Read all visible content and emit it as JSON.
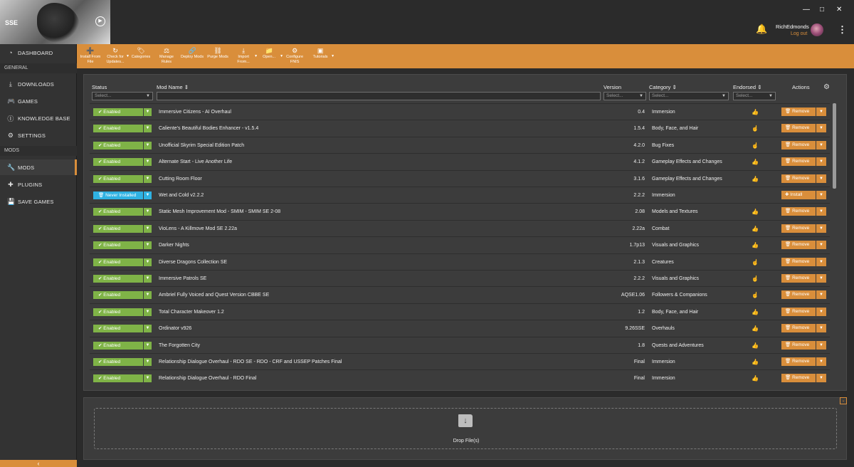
{
  "game": {
    "label": "SSE"
  },
  "window": {
    "minimize": "—",
    "maximize": "□",
    "close": "✕"
  },
  "user": {
    "name": "RichEdmonds",
    "logout": "Log out"
  },
  "sidebar": {
    "dashboard": "DASHBOARD",
    "section_general": "GENERAL",
    "downloads": "DOWNLOADS",
    "games": "GAMES",
    "knowledge_base": "KNOWLEDGE BASE",
    "settings": "SETTINGS",
    "section_mods": "MODS",
    "mods": "MODS",
    "plugins": "PLUGINS",
    "save_games": "SAVE GAMES"
  },
  "toolbar": [
    {
      "l1": "Install From",
      "l2": "File",
      "icon": "plus-icon",
      "glyph": "➕"
    },
    {
      "l1": "Check for",
      "l2": "Updates...",
      "icon": "refresh-icon",
      "glyph": "↻",
      "caret": true
    },
    {
      "l1": "Categories",
      "l2": "",
      "icon": "tag-icon",
      "glyph": "🏷"
    },
    {
      "l1": "Manage",
      "l2": "Rules",
      "icon": "rules-icon",
      "glyph": "⚖"
    },
    {
      "l1": "Deploy Mods",
      "l2": "",
      "icon": "link-icon",
      "glyph": "🔗"
    },
    {
      "l1": "Purge Mods",
      "l2": "",
      "icon": "unlink-icon",
      "glyph": "⛓"
    },
    {
      "l1": "Import",
      "l2": "From...",
      "icon": "import-icon",
      "glyph": "⤓",
      "caret": true
    },
    {
      "l1": "Open...",
      "l2": "",
      "icon": "folder-icon",
      "glyph": "📁",
      "caret": true
    },
    {
      "l1": "Configure",
      "l2": "FNIS",
      "icon": "gear-icon",
      "glyph": "⚙"
    },
    {
      "l1": "Tutorials",
      "l2": "",
      "icon": "video-icon",
      "glyph": "▣",
      "caret": true
    }
  ],
  "columns": {
    "status": "Status",
    "mod_name": "Mod Name",
    "version": "Version",
    "category": "Category",
    "endorsed": "Endorsed",
    "actions": "Actions",
    "select_placeholder": "Select..."
  },
  "mods": [
    {
      "status": "Enabled",
      "name": "Immersive Citizens - AI Overhaul",
      "version": "0.4",
      "category": "Immersion",
      "endorsed": "filled",
      "action": "Remove"
    },
    {
      "status": "Enabled",
      "name": "Caliente's Beautiful Bodies Enhancer - v1.5.4",
      "version": "1.5.4",
      "category": "Body, Face, and Hair",
      "endorsed": "outline",
      "action": "Remove"
    },
    {
      "status": "Enabled",
      "name": "Unofficial Skyrim Special Edition Patch",
      "version": "4.2.0",
      "category": "Bug Fixes",
      "endorsed": "outline",
      "action": "Remove"
    },
    {
      "status": "Enabled",
      "name": "Alternate Start - Live Another Life",
      "version": "4.1.2",
      "category": "Gameplay Effects and Changes",
      "endorsed": "filled",
      "action": "Remove"
    },
    {
      "status": "Enabled",
      "name": "Cutting Room Floor",
      "version": "3.1.6",
      "category": "Gameplay Effects and Changes",
      "endorsed": "filled",
      "action": "Remove"
    },
    {
      "status": "Never Installed",
      "name": "Wet and Cold v2.2.2",
      "version": "2.2.2",
      "category": "Immersion",
      "endorsed": "",
      "action": "Install"
    },
    {
      "status": "Enabled",
      "name": "Static Mesh Improvement Mod - SMIM - SMIM SE 2-08",
      "version": "2.08",
      "category": "Models and Textures",
      "endorsed": "filled",
      "action": "Remove"
    },
    {
      "status": "Enabled",
      "name": "VioLens - A Killmove Mod SE 2.22a",
      "version": "2.22a",
      "category": "Combat",
      "endorsed": "filled",
      "action": "Remove"
    },
    {
      "status": "Enabled",
      "name": "Darker Nights",
      "version": "1.7p13",
      "category": "Visuals and Graphics",
      "endorsed": "filled",
      "action": "Remove"
    },
    {
      "status": "Enabled",
      "name": "Diverse Dragons Collection SE",
      "version": "2.1.3",
      "category": "Creatures",
      "endorsed": "outline",
      "action": "Remove"
    },
    {
      "status": "Enabled",
      "name": "Immersive Patrols SE",
      "version": "2.2.2",
      "category": "Visuals and Graphics",
      "endorsed": "outline",
      "action": "Remove"
    },
    {
      "status": "Enabled",
      "name": "Ambriel Fully Voiced and Quest Version CBBE SE",
      "version": "AQSE1.06",
      "category": "Followers & Companions",
      "endorsed": "outline",
      "action": "Remove"
    },
    {
      "status": "Enabled",
      "name": "Total Character Makeover 1.2",
      "version": "1.2",
      "category": "Body, Face, and Hair",
      "endorsed": "filled",
      "action": "Remove"
    },
    {
      "status": "Enabled",
      "name": "Ordinator v926",
      "version": "9.26SSE",
      "category": "Overhauls",
      "endorsed": "filled",
      "action": "Remove"
    },
    {
      "status": "Enabled",
      "name": "The Forgotten City",
      "version": "1.8",
      "category": "Quests and Adventures",
      "endorsed": "filled",
      "action": "Remove"
    },
    {
      "status": "Enabled",
      "name": "Relationship Dialogue Overhaul - RDO SE - RDO - CRF and USSEP Patches Final",
      "version": "Final",
      "category": "Immersion",
      "endorsed": "filled",
      "action": "Remove"
    },
    {
      "status": "Enabled",
      "name": "Relationship Dialogue Overhaul - RDO Final",
      "version": "Final",
      "category": "Immersion",
      "endorsed": "filled",
      "action": "Remove"
    }
  ],
  "dropzone": {
    "label": "Drop File(s)"
  },
  "colors": {
    "accent": "#d98e3b",
    "enabled": "#7fb347",
    "never_installed": "#2fb2e3",
    "background": "#2b2b2b"
  }
}
